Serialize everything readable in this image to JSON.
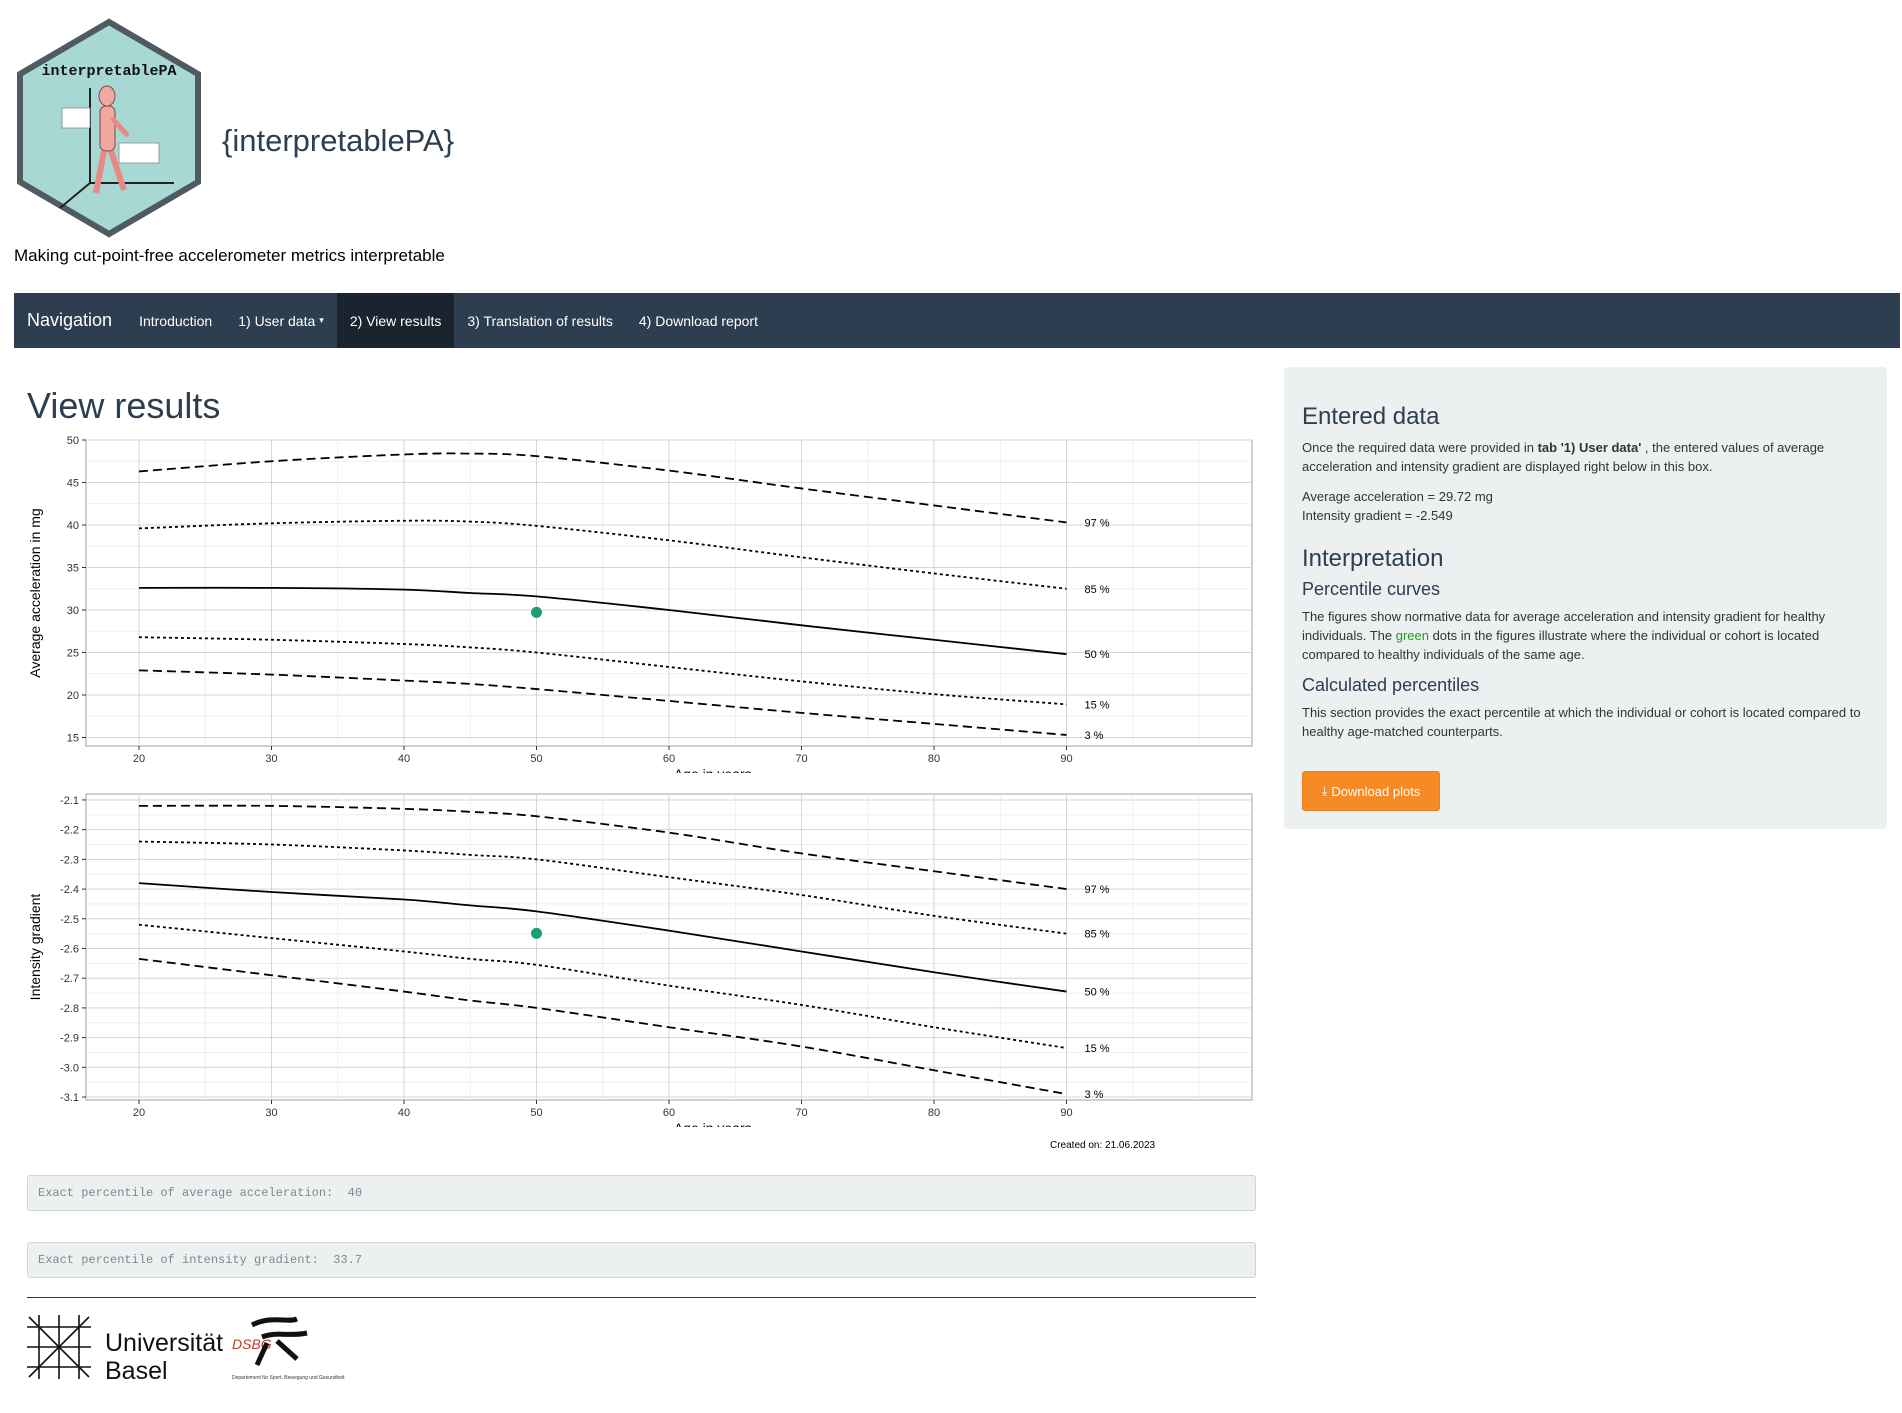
{
  "header": {
    "logo_text": "interpretablePA",
    "app_title": "{interpretablePA}",
    "subtitle": "Making cut-point-free accelerometer metrics interpretable"
  },
  "navbar": {
    "brand": "Navigation",
    "items": [
      {
        "label": "Introduction",
        "active": false
      },
      {
        "label": "1) User data",
        "active": false,
        "dropdown": true
      },
      {
        "label": "2) View results",
        "active": true
      },
      {
        "label": "3) Translation of results",
        "active": false
      },
      {
        "label": "4) Download report",
        "active": false
      }
    ]
  },
  "main": {
    "title": "View results",
    "created": "Created on: 21.06.2023",
    "percentile_acc": "Exact percentile of average acceleration:  40",
    "percentile_ig": "Exact percentile of intensity gradient:  33.7"
  },
  "sidebar": {
    "h_entered": "Entered data",
    "entered_p_before": "Once the required data were provided in ",
    "entered_p_bold": "tab '1) User data'",
    "entered_p_after": " , the entered values of average acceleration and intensity gradient are displayed right below in this box.",
    "avg_acc": "Average acceleration = 29.72 mg",
    "int_grad": "Intensity gradient = -2.549",
    "h_interp": "Interpretation",
    "h_curves": "Percentile curves",
    "curves_p_before": "The figures show normative data for average acceleration and intensity gradient for healthy individuals. The ",
    "curves_p_green": "green",
    "curves_p_after": " dots in the figures illustrate where the individual or cohort is located compared to healthy individuals of the same age.",
    "h_calc": "Calculated percentiles",
    "calc_p": "This section provides the exact percentile at which the individual or cohort is located compared to healthy age-matched counterparts.",
    "button": "Download plots"
  },
  "footer": {
    "uni_line1": "Universität",
    "uni_line2": "Basel",
    "dsbg": "DSBG",
    "dsbg_sub": "Departement für Sport, Bewegung und Gesundheit"
  },
  "colors": {
    "navbar": "#2c3e50",
    "navbar_active": "#1a242f",
    "button": "#f68a25",
    "point": "#1b9e77",
    "sidebar": "#ecf0f1"
  },
  "chart_data": [
    {
      "type": "line",
      "xlabel": "Age in years",
      "ylabel": "Average acceleration in mg",
      "xlim": [
        16,
        104
      ],
      "ylim": [
        14,
        50
      ],
      "xticks": [
        20,
        30,
        40,
        50,
        60,
        70,
        80,
        90
      ],
      "yticks": [
        15,
        20,
        25,
        30,
        35,
        40,
        45,
        50
      ],
      "grid": true,
      "x": [
        20,
        30,
        40,
        45,
        50,
        60,
        70,
        80,
        90
      ],
      "series": [
        {
          "name": "97 %",
          "dash": "long",
          "values": [
            46.3,
            47.5,
            48.3,
            48.4,
            48.1,
            46.4,
            44.3,
            42.3,
            40.3
          ]
        },
        {
          "name": "85 %",
          "dash": "short",
          "values": [
            39.6,
            40.2,
            40.5,
            40.4,
            39.9,
            38.2,
            36.2,
            34.3,
            32.5
          ]
        },
        {
          "name": "50 %",
          "dash": "solid",
          "values": [
            32.6,
            32.6,
            32.4,
            32.0,
            31.6,
            30.0,
            28.2,
            26.5,
            24.8
          ]
        },
        {
          "name": "15 %",
          "dash": "short",
          "values": [
            26.8,
            26.5,
            26.0,
            25.6,
            25.0,
            23.3,
            21.6,
            20.1,
            18.9
          ]
        },
        {
          "name": "3 %",
          "dash": "long",
          "values": [
            22.9,
            22.4,
            21.7,
            21.3,
            20.7,
            19.3,
            17.9,
            16.6,
            15.3
          ]
        }
      ],
      "points": [
        {
          "x": 50,
          "y": 29.72
        }
      ]
    },
    {
      "type": "line",
      "xlabel": "Age in years",
      "ylabel": "Intensity gradient",
      "xlim": [
        16,
        104
      ],
      "ylim": [
        -3.11,
        -2.08
      ],
      "xticks": [
        20,
        30,
        40,
        50,
        60,
        70,
        80,
        90
      ],
      "yticks": [
        -2.1,
        -2.2,
        -2.3,
        -2.4,
        -2.5,
        -2.6,
        -2.7,
        -2.8,
        -2.9,
        -3.0,
        -3.1
      ],
      "ytick_labels": [
        "-2.1",
        "-2.2",
        "-2.3",
        "-2.4",
        "-2.5",
        "-2.6",
        "-2.7",
        "-2.8",
        "-2.9",
        "-3.0",
        "-3.1"
      ],
      "grid": true,
      "x": [
        20,
        30,
        40,
        45,
        50,
        60,
        70,
        80,
        90
      ],
      "series": [
        {
          "name": "97 %",
          "dash": "long",
          "values": [
            -2.12,
            -2.12,
            -2.13,
            -2.14,
            -2.155,
            -2.21,
            -2.28,
            -2.34,
            -2.4
          ]
        },
        {
          "name": "85 %",
          "dash": "short",
          "values": [
            -2.24,
            -2.25,
            -2.27,
            -2.285,
            -2.3,
            -2.36,
            -2.42,
            -2.49,
            -2.55
          ]
        },
        {
          "name": "50 %",
          "dash": "solid",
          "values": [
            -2.38,
            -2.41,
            -2.435,
            -2.455,
            -2.475,
            -2.54,
            -2.61,
            -2.68,
            -2.745
          ]
        },
        {
          "name": "15 %",
          "dash": "short",
          "values": [
            -2.52,
            -2.565,
            -2.61,
            -2.635,
            -2.655,
            -2.725,
            -2.79,
            -2.865,
            -2.935
          ]
        },
        {
          "name": "3 %",
          "dash": "long",
          "values": [
            -2.635,
            -2.69,
            -2.745,
            -2.775,
            -2.8,
            -2.865,
            -2.93,
            -3.01,
            -3.09
          ]
        }
      ],
      "points": [
        {
          "x": 50,
          "y": -2.549
        }
      ]
    }
  ]
}
